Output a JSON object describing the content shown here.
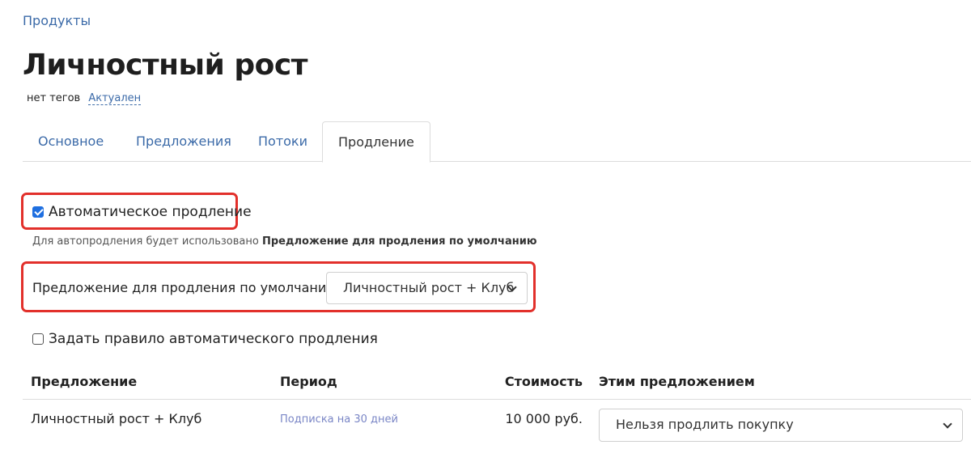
{
  "breadcrumb": {
    "label": "Продукты"
  },
  "page": {
    "title": "Личностный рост",
    "tags_text": "нет тегов",
    "status": "Актуален"
  },
  "tabs": [
    {
      "label": "Основное",
      "active": false
    },
    {
      "label": "Предложения",
      "active": false
    },
    {
      "label": "Потоки",
      "active": false
    },
    {
      "label": "Продление",
      "active": true
    }
  ],
  "renewal": {
    "auto_label": "Автоматическое продление",
    "auto_checked": true,
    "hint_prefix": "Для автопродления будет использовано",
    "hint_bold": "Предложение для продления по умолчанию",
    "default_offer_label": "Предложение для продления по умолчанию:",
    "default_offer_value": "Личностный рост + Клуб",
    "rule_label": "Задать правило автоматического продления",
    "rule_checked": false
  },
  "table": {
    "headers": [
      "Предложение",
      "Период",
      "Стоимость",
      "Этим предложением"
    ],
    "rows": [
      {
        "offer": "Личностный рост + Клуб",
        "period": "Подписка на 30 дней",
        "price": "10 000 руб.",
        "action": "Нельзя продлить покупку"
      }
    ]
  },
  "colors": {
    "accent": "#3b6aa8",
    "highlight": "#e2302b",
    "checkbox": "#1f6fe0"
  }
}
